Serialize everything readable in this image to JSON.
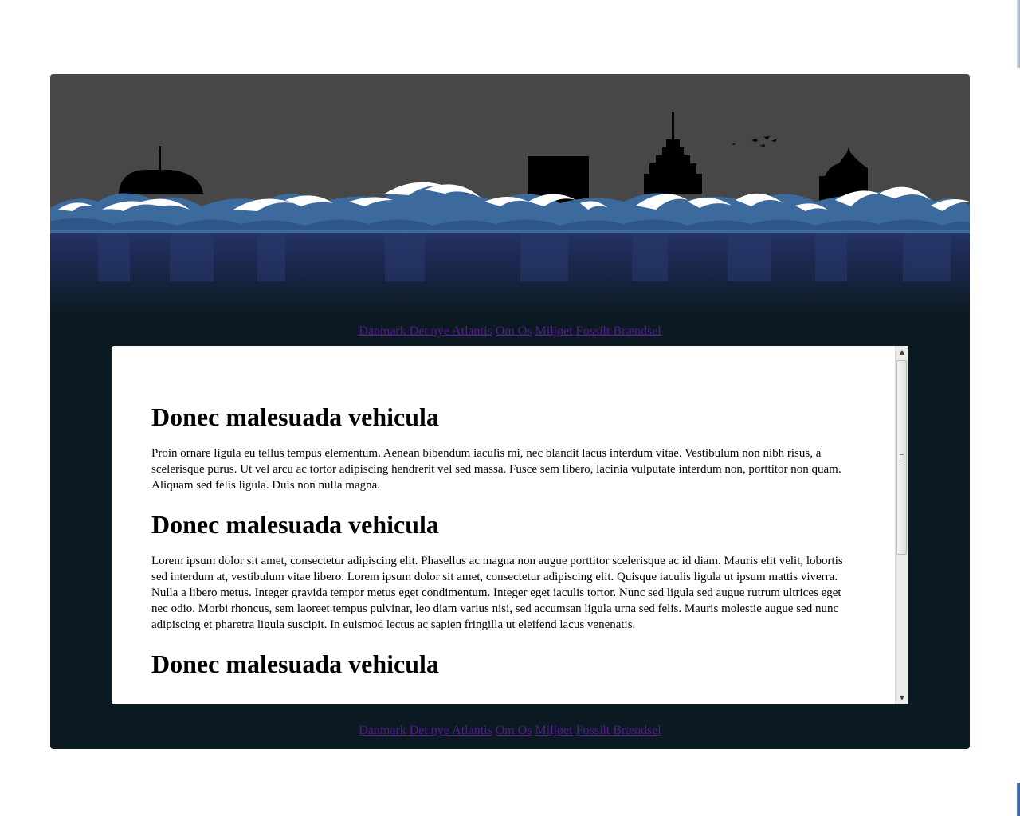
{
  "nav": {
    "items": [
      {
        "label": "Danmark Det nye Atlantis"
      },
      {
        "label": "Om Os"
      },
      {
        "label": "Miljøet"
      },
      {
        "label": "Fossilt Brændsel"
      }
    ]
  },
  "article": {
    "sections": [
      {
        "heading": "Donec malesuada vehicula",
        "body": "Proin ornare ligula eu tellus tempus elementum. Aenean bibendum iaculis mi, nec blandit lacus interdum vitae. Vestibulum non nibh risus, a scelerisque purus. Ut vel arcu ac tortor adipiscing hendrerit vel sed massa. Fusce sem libero, lacinia vulputate interdum non, porttitor non quam. Aliquam sed felis ligula. Duis non nulla magna."
      },
      {
        "heading": "Donec malesuada vehicula",
        "body": "Lorem ipsum dolor sit amet, consectetur adipiscing elit. Phasellus ac magna non augue porttitor scelerisque ac id diam. Mauris elit velit, lobortis sed interdum at, vestibulum vitae libero. Lorem ipsum dolor sit amet, consectetur adipiscing elit. Quisque iaculis ligula ut ipsum mattis viverra. Nulla a libero metus. Integer gravida tempor metus eget condimentum. Integer eget iaculis tortor. Nunc sed ligula sed augue rutrum ultrices eget nec odio. Morbi rhoncus, sem laoreet tempus pulvinar, leo diam varius nisi, sed accumsan ligula urna sed felis. Mauris molestie augue sed nunc adipiscing et pharetra ligula suscipit. In euismod lectus ac sapien fringilla ut eleifend lacus venenatis."
      },
      {
        "heading": "Donec malesuada vehicula",
        "body": ""
      }
    ]
  },
  "scroll": {
    "position": 0
  },
  "colors": {
    "sky": "#474747",
    "sea_top": "#27356a",
    "sea_bottom": "#0b1a22",
    "wave_blue": "#3c6a9c",
    "link": "#551a8b"
  },
  "icons": {
    "scroll_up": "▲",
    "scroll_down": "▼"
  }
}
